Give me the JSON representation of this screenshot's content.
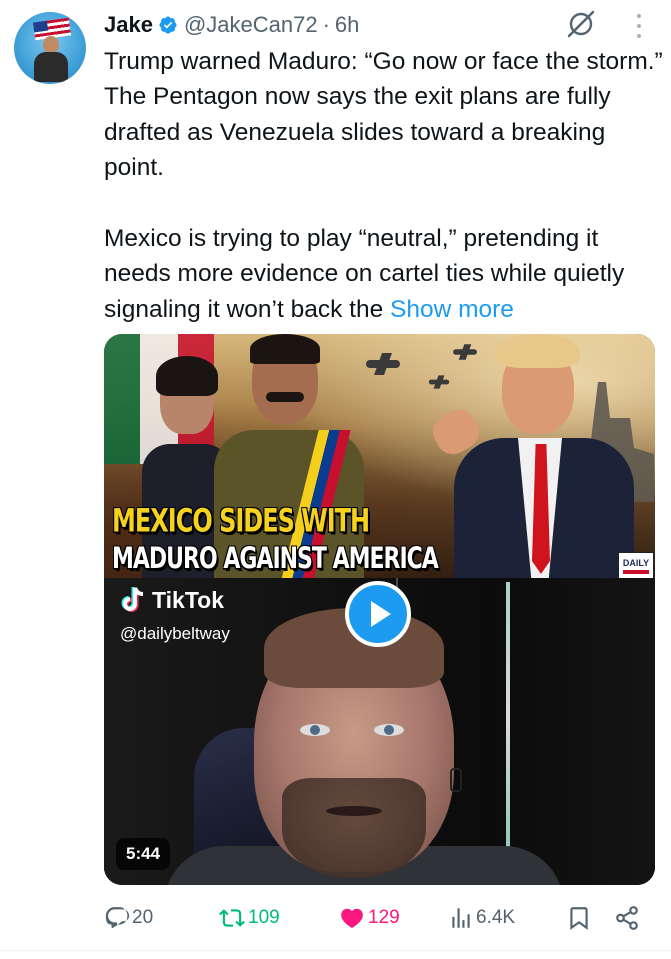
{
  "author": {
    "name": "Jake",
    "handle": "@JakeCan72",
    "separator": "·",
    "time": "6h"
  },
  "tweet": {
    "paragraph1": "Trump warned Maduro: “Go now or face the storm.” The Pentagon now says the exit plans are fully drafted as Venezuela slides toward a breaking point.",
    "paragraph2": "Mexico is trying to play “neutral,” pretending it needs more evidence on cartel ties while quietly signaling it won’t back the",
    "show_more": "Show more"
  },
  "media": {
    "thumbnail_headline_line1": "MEXICO SIDES WITH",
    "thumbnail_headline_line2": "MADURO AGAINST AMERICA",
    "thumbnail_logo": "DAILY",
    "tiktok_brand": "TikTok",
    "tiktok_handle": "@dailybeltway",
    "duration": "5:44"
  },
  "actions": {
    "replies": "20",
    "reposts": "109",
    "likes": "129",
    "views": "6.4K"
  },
  "colors": {
    "accent": "#1d9bf0",
    "repost": "#00ba7c",
    "like": "#f91880",
    "muted": "#536471",
    "headline_yellow": "#f5d21d"
  },
  "icons": [
    "verified-badge-icon",
    "grok-icon",
    "more-icon",
    "tiktok-icon",
    "play-icon",
    "reply-icon",
    "repost-icon",
    "like-icon",
    "views-icon",
    "bookmark-icon",
    "share-icon"
  ]
}
